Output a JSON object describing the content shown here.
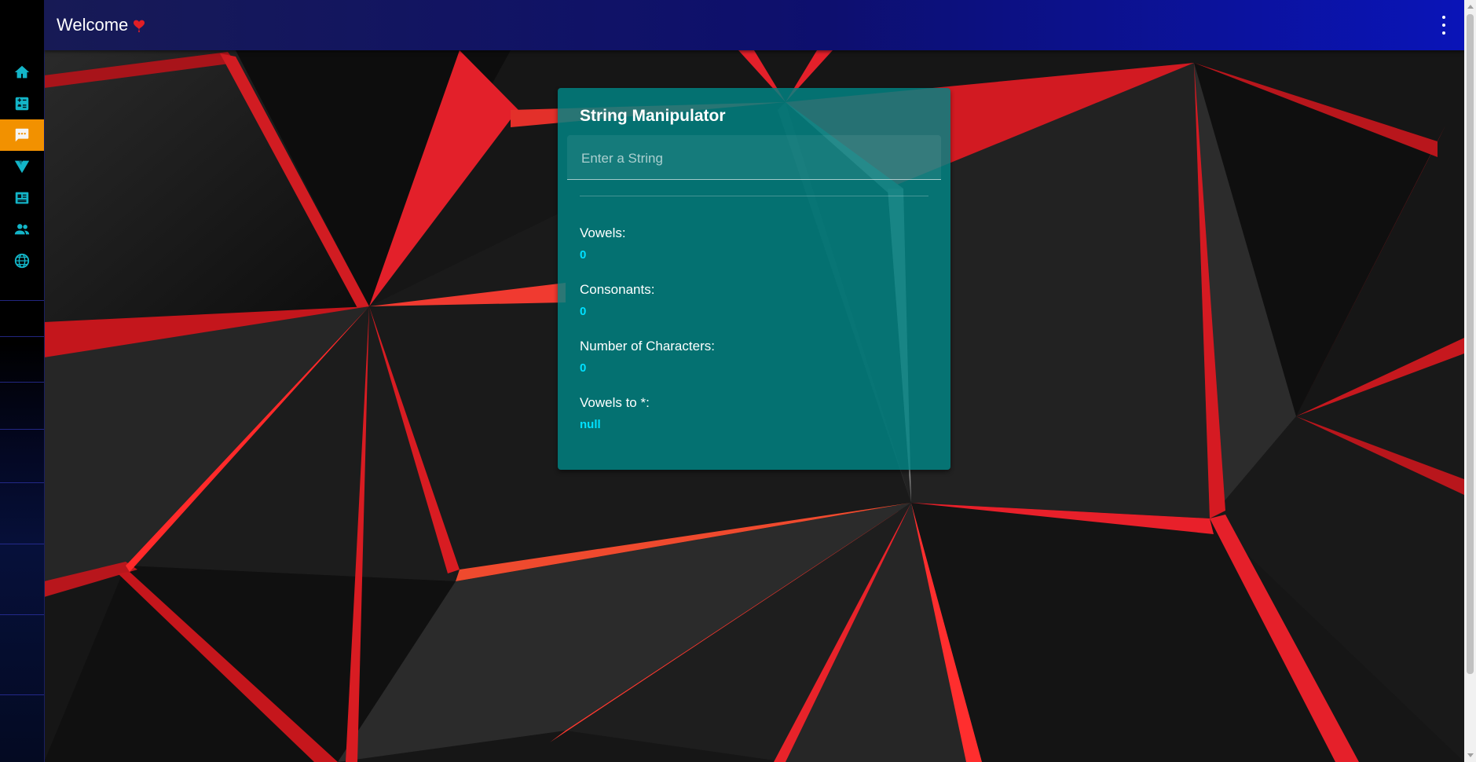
{
  "appbar": {
    "title": "Welcome",
    "heart_icon": "heart-icon",
    "menu_icon": "more-vert-icon"
  },
  "rail": {
    "items": [
      {
        "icon": "home-icon"
      },
      {
        "icon": "calculator-icon"
      },
      {
        "icon": "chat-icon",
        "active": true
      },
      {
        "icon": "vuetify-icon"
      },
      {
        "icon": "newspaper-icon"
      },
      {
        "icon": "people-icon"
      },
      {
        "icon": "globe-icon"
      }
    ]
  },
  "card": {
    "title": "String Manipulator",
    "input_placeholder": "Enter a String",
    "input_value": "",
    "stats": [
      {
        "label": "Vowels:",
        "value": "0"
      },
      {
        "label": "Consonants:",
        "value": "0"
      },
      {
        "label": "Number of Characters:",
        "value": "0"
      },
      {
        "label": "Vowels to *:",
        "value": "null"
      }
    ]
  },
  "colors": {
    "accent": "#f29100",
    "card": "#008585",
    "value": "#00e0ff",
    "appbar": "#0d0f6e"
  }
}
